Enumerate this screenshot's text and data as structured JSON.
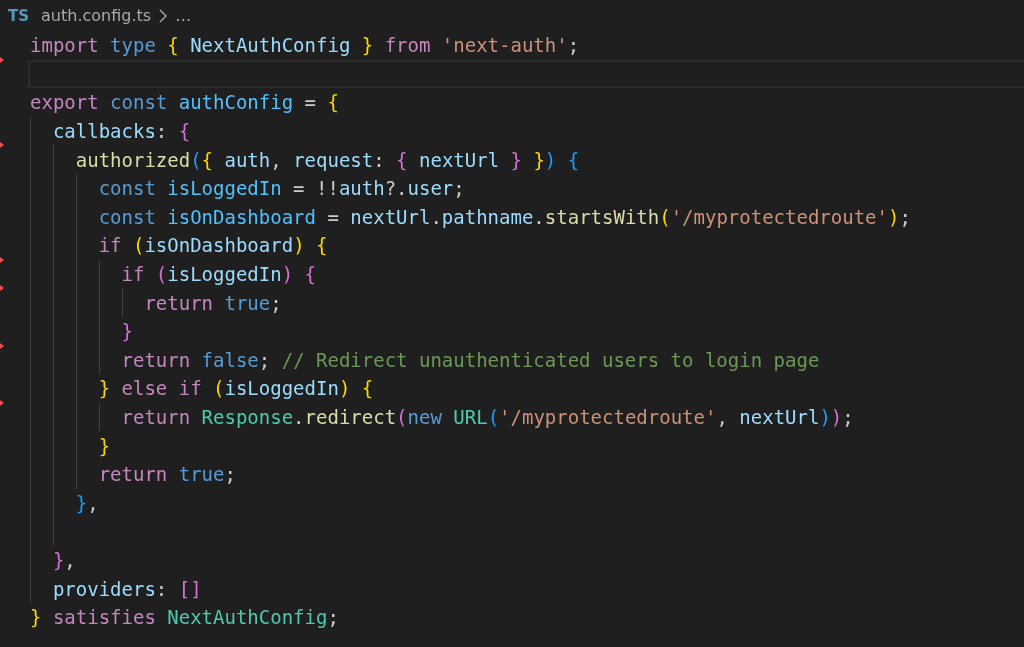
{
  "breadcrumb": {
    "file_type": "TS",
    "file": "auth.config.ts",
    "more": "…"
  },
  "lines": [
    {
      "current": false,
      "deleted_mark": false,
      "tokens": [
        {
          "kind": "kw",
          "text": "import "
        },
        {
          "kind": "st",
          "text": "type "
        },
        {
          "kind": "b1",
          "text": "{ "
        },
        {
          "kind": "var",
          "text": "NextAuthConfig "
        },
        {
          "kind": "b1",
          "text": "} "
        },
        {
          "kind": "kw",
          "text": "from "
        },
        {
          "kind": "str",
          "text": "'next-auth'"
        },
        {
          "kind": "p",
          "text": ";"
        }
      ]
    },
    {
      "current": true,
      "deleted_mark": true
    },
    {
      "current": false,
      "deleted_mark": false,
      "tokens": [
        {
          "kind": "kw",
          "text": "export "
        },
        {
          "kind": "st",
          "text": "const "
        },
        {
          "kind": "const",
          "text": "authConfig "
        },
        {
          "kind": "p",
          "text": "= "
        },
        {
          "kind": "b1",
          "text": "{"
        }
      ],
      "children": [
        {
          "current": false,
          "deleted_mark": false,
          "tokens": [
            {
              "kind": "var",
              "text": "callbacks"
            },
            {
              "kind": "p",
              "text": ": "
            },
            {
              "kind": "b2",
              "text": "{"
            }
          ],
          "children": [
            {
              "current": false,
              "deleted_mark": true,
              "tokens": [
                {
                  "kind": "fn",
                  "text": "authorized"
                },
                {
                  "kind": "b3",
                  "text": "("
                },
                {
                  "kind": "b1",
                  "text": "{ "
                },
                {
                  "kind": "var",
                  "text": "auth"
                },
                {
                  "kind": "p",
                  "text": ", "
                },
                {
                  "kind": "var",
                  "text": "request"
                },
                {
                  "kind": "p",
                  "text": ": "
                },
                {
                  "kind": "b2",
                  "text": "{ "
                },
                {
                  "kind": "var",
                  "text": "nextUrl "
                },
                {
                  "kind": "b2",
                  "text": "} "
                },
                {
                  "kind": "b1",
                  "text": "}"
                },
                {
                  "kind": "b3",
                  "text": ") "
                },
                {
                  "kind": "b3",
                  "text": "{"
                }
              ],
              "children": [
                {
                  "current": false,
                  "deleted_mark": false,
                  "tokens": [
                    {
                      "kind": "st",
                      "text": "const "
                    },
                    {
                      "kind": "const",
                      "text": "isLoggedIn "
                    },
                    {
                      "kind": "p",
                      "text": "= !!"
                    },
                    {
                      "kind": "var",
                      "text": "auth"
                    },
                    {
                      "kind": "p",
                      "text": "?."
                    },
                    {
                      "kind": "var",
                      "text": "user"
                    },
                    {
                      "kind": "p",
                      "text": ";"
                    }
                  ]
                },
                {
                  "current": false,
                  "deleted_mark": false,
                  "tokens": [
                    {
                      "kind": "st",
                      "text": "const "
                    },
                    {
                      "kind": "const",
                      "text": "isOnDashboard "
                    },
                    {
                      "kind": "p",
                      "text": "= "
                    },
                    {
                      "kind": "var",
                      "text": "nextUrl"
                    },
                    {
                      "kind": "p",
                      "text": "."
                    },
                    {
                      "kind": "var",
                      "text": "pathname"
                    },
                    {
                      "kind": "p",
                      "text": "."
                    },
                    {
                      "kind": "fn",
                      "text": "startsWith"
                    },
                    {
                      "kind": "b1",
                      "text": "("
                    },
                    {
                      "kind": "str",
                      "text": "'/myprotectedroute'"
                    },
                    {
                      "kind": "b1",
                      "text": ")"
                    },
                    {
                      "kind": "p",
                      "text": ";"
                    }
                  ]
                },
                {
                  "current": false,
                  "deleted_mark": false,
                  "tokens": [
                    {
                      "kind": "kw",
                      "text": "if "
                    },
                    {
                      "kind": "b1",
                      "text": "("
                    },
                    {
                      "kind": "var",
                      "text": "isOnDashboard"
                    },
                    {
                      "kind": "b1",
                      "text": ") "
                    },
                    {
                      "kind": "b1",
                      "text": "{"
                    }
                  ],
                  "children": [
                    {
                      "current": false,
                      "deleted_mark": true,
                      "tokens": [
                        {
                          "kind": "kw",
                          "text": "if "
                        },
                        {
                          "kind": "b2",
                          "text": "("
                        },
                        {
                          "kind": "var",
                          "text": "isLoggedIn"
                        },
                        {
                          "kind": "b2",
                          "text": ") "
                        },
                        {
                          "kind": "b2",
                          "text": "{"
                        }
                      ],
                      "children": [
                        {
                          "current": false,
                          "deleted_mark": true,
                          "tokens": [
                            {
                              "kind": "kw",
                              "text": "return "
                            },
                            {
                              "kind": "st",
                              "text": "true"
                            },
                            {
                              "kind": "p",
                              "text": ";"
                            }
                          ]
                        }
                      ]
                    },
                    {
                      "current": false,
                      "deleted_mark": false,
                      "tokens": [
                        {
                          "kind": "b2",
                          "text": "}"
                        }
                      ]
                    },
                    {
                      "current": false,
                      "deleted_mark": true,
                      "tokens": [
                        {
                          "kind": "kw",
                          "text": "return "
                        },
                        {
                          "kind": "st",
                          "text": "false"
                        },
                        {
                          "kind": "p",
                          "text": "; "
                        },
                        {
                          "kind": "cmt",
                          "text": "// Redirect unauthenticated users to login page"
                        }
                      ]
                    }
                  ]
                },
                {
                  "current": false,
                  "deleted_mark": false,
                  "tokens": [
                    {
                      "kind": "b1",
                      "text": "} "
                    },
                    {
                      "kind": "kw",
                      "text": "else if "
                    },
                    {
                      "kind": "b1",
                      "text": "("
                    },
                    {
                      "kind": "var",
                      "text": "isLoggedIn"
                    },
                    {
                      "kind": "b1",
                      "text": ") "
                    },
                    {
                      "kind": "b1",
                      "text": "{"
                    }
                  ],
                  "children": [
                    {
                      "current": false,
                      "deleted_mark": true,
                      "tokens": [
                        {
                          "kind": "kw",
                          "text": "return "
                        },
                        {
                          "kind": "type",
                          "text": "Response"
                        },
                        {
                          "kind": "p",
                          "text": "."
                        },
                        {
                          "kind": "fn",
                          "text": "redirect"
                        },
                        {
                          "kind": "b2",
                          "text": "("
                        },
                        {
                          "kind": "st",
                          "text": "new "
                        },
                        {
                          "kind": "type",
                          "text": "URL"
                        },
                        {
                          "kind": "b3",
                          "text": "("
                        },
                        {
                          "kind": "str",
                          "text": "'/myprotectedroute'"
                        },
                        {
                          "kind": "p",
                          "text": ", "
                        },
                        {
                          "kind": "var",
                          "text": "nextUrl"
                        },
                        {
                          "kind": "b3",
                          "text": ")"
                        },
                        {
                          "kind": "b2",
                          "text": ")"
                        },
                        {
                          "kind": "p",
                          "text": ";"
                        }
                      ]
                    }
                  ]
                },
                {
                  "current": false,
                  "deleted_mark": false,
                  "tokens": [
                    {
                      "kind": "b1",
                      "text": "}"
                    }
                  ]
                },
                {
                  "current": false,
                  "deleted_mark": false,
                  "tokens": [
                    {
                      "kind": "kw",
                      "text": "return "
                    },
                    {
                      "kind": "st",
                      "text": "true"
                    },
                    {
                      "kind": "p",
                      "text": ";"
                    }
                  ]
                }
              ]
            },
            {
              "current": false,
              "deleted_mark": false,
              "tokens": [
                {
                  "kind": "b3",
                  "text": "}"
                },
                {
                  "kind": "p",
                  "text": ","
                }
              ]
            },
            {
              "current": false,
              "deleted_mark": false
            }
          ]
        },
        {
          "current": false,
          "deleted_mark": false,
          "tokens": [
            {
              "kind": "b2",
              "text": "}"
            },
            {
              "kind": "p",
              "text": ","
            }
          ]
        },
        {
          "current": false,
          "deleted_mark": false,
          "tokens": [
            {
              "kind": "var",
              "text": "providers"
            },
            {
              "kind": "p",
              "text": ": "
            },
            {
              "kind": "b2",
              "text": "[]"
            }
          ]
        }
      ]
    },
    {
      "current": false,
      "deleted_mark": false,
      "tokens": [
        {
          "kind": "b1",
          "text": "} "
        },
        {
          "kind": "kw",
          "text": "satisfies "
        },
        {
          "kind": "type",
          "text": "NextAuthConfig"
        },
        {
          "kind": "p",
          "text": ";"
        }
      ]
    }
  ]
}
